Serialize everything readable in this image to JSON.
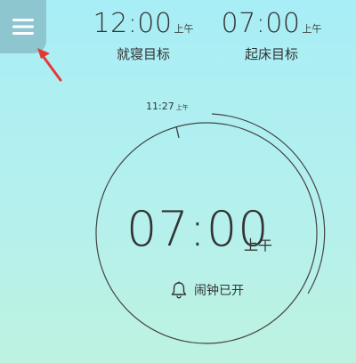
{
  "menu": {
    "icon": "hamburger-menu-icon"
  },
  "annotation": {
    "icon": "red-arrow-pointer-icon",
    "color": "#e53935"
  },
  "sleep_target": {
    "time": "12:00",
    "ampm": "上午",
    "label": "就寝目标"
  },
  "wake_target": {
    "time": "07:00",
    "ampm": "上午",
    "label": "起床目标"
  },
  "clock": {
    "current_time": "11:27",
    "current_ampm": "上午",
    "alarm_time": "07:00",
    "alarm_ampm": "上午",
    "alarm_status": "闹钟已开",
    "alarm_icon": "bell-icon"
  },
  "colors": {
    "menu_bg": "#8ec6d0",
    "text": "#333333",
    "bg_top": "#a8eef6",
    "bg_bottom": "#bdf2e0"
  }
}
